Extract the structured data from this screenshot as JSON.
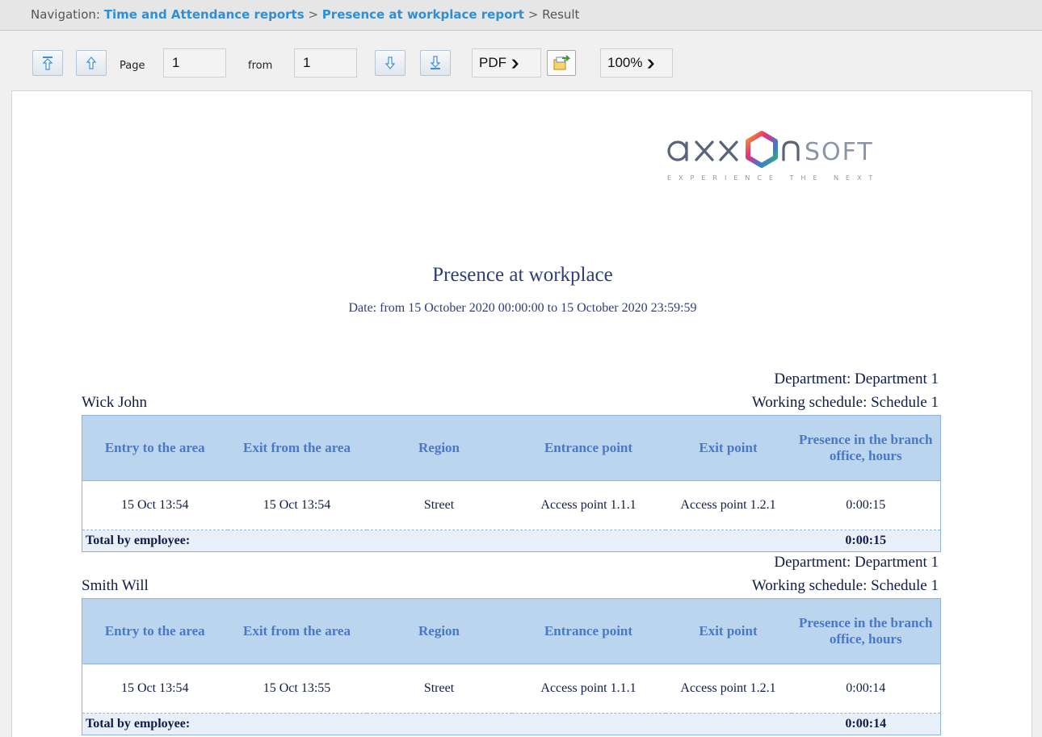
{
  "nav": {
    "prefix": "Navigation:",
    "link1": "Time and Attendance reports",
    "sep1": ">",
    "link2": "Presence at workplace report",
    "sep2": ">",
    "current": "Result"
  },
  "toolbar": {
    "page_label": "Page",
    "page_value": "1",
    "from_label": "from",
    "from_value": "1",
    "format_selected": "PDF",
    "zoom_selected": "100%",
    "icons": [
      "first-page-icon",
      "prev-page-icon",
      "next-page-icon",
      "last-page-icon",
      "export-icon"
    ]
  },
  "logo": {
    "wordmark": "axxonsoft",
    "tagline": "EXPERIENCE THE NEXT"
  },
  "report": {
    "title": "Presence at workplace",
    "date_range": "Date: from 15 October 2020 00:00:00 to 15 October 2020 23:59:59",
    "columns": [
      "Entry to the area",
      "Exit from the area",
      "Region",
      "Entrance point",
      "Exit point",
      "Presence in the branch office, hours"
    ],
    "total_label": "Total by employee:",
    "employees": [
      {
        "name": "Wick John",
        "department": "Department: Department 1",
        "schedule": "Working schedule: Schedule 1",
        "rows": [
          [
            "15 Oct 13:54",
            "15 Oct 13:54",
            "Street",
            "Access point 1.1.1",
            "Access point 1.2.1",
            "0:00:15"
          ]
        ],
        "total": "0:00:15"
      },
      {
        "name": "Smith Will",
        "department": "Department: Department 1",
        "schedule": "Working schedule: Schedule 1",
        "rows": [
          [
            "15 Oct 13:54",
            "15 Oct 13:55",
            "Street",
            "Access point 1.1.1",
            "Access point 1.2.1",
            "0:00:14"
          ]
        ],
        "total": "0:00:14"
      }
    ]
  },
  "colors": {
    "link": "#2f8fd6",
    "header_bg": "#bcd5ee",
    "header_text": "#4a78c8",
    "title_text": "#2d3f7a"
  }
}
